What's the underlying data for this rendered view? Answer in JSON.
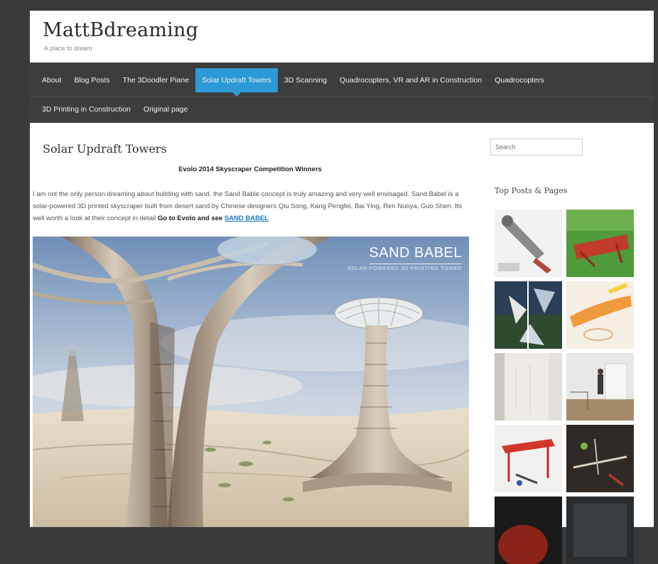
{
  "site": {
    "title": "MattBdreaming",
    "tagline": "A place to dream"
  },
  "nav": {
    "row1": [
      "About",
      "Blog Posts",
      "The 3Doodler Piane",
      "Solar Updraft Towers",
      "3D Scanning",
      "Quadrocopters, VR and AR in Construction",
      "Quadrocopters"
    ],
    "row2": [
      "3D Printing in Construction",
      "Original page"
    ],
    "active": "Solar Updraft Towers"
  },
  "post": {
    "title": "Solar Updraft Towers",
    "subtitle": "Evolo 2014 Skyscraper Competition Winners",
    "paragraph": "I am not the only person dreaming about building with sand, the Sand Bable concept is truly amazing and very well envisaged. Sand Babel is a solar-powered 3D printed skyscraper built from desert sand by Chinese designers Qiu Song, Kang Pengfei, Bai Ying, Ren Nuoya, Guo Shen. Its well worth a look at their concept in detail",
    "cta_text": "Go to Evolo and see",
    "cta_link": "SAND BABEL"
  },
  "hero": {
    "title": "SAND BABEL",
    "subtitle": "SOLAR-POWERED 3D PRINTING TOWER"
  },
  "sidebar": {
    "search_placeholder": "Search",
    "widget_title": "Top Posts & Pages",
    "thumbs": [
      "robot-arm",
      "red-printer-on-grass",
      "abstract-forms",
      "orange-printed-object",
      "white-wall",
      "man-in-room",
      "red-gantry-printer",
      "printer-figures",
      "dark-red-thumb",
      "dark-grey-thumb"
    ]
  },
  "colors": {
    "nav_bg": "#3d3d3d",
    "accent": "#2b9ad6",
    "link": "#1a7ac0"
  }
}
